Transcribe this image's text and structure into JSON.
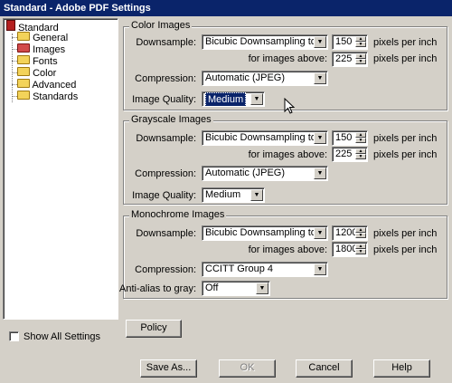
{
  "window": {
    "title": "Standard - Adobe PDF Settings"
  },
  "tree": {
    "root": "Standard",
    "items": [
      {
        "label": "General",
        "icon": "folder-icon"
      },
      {
        "label": "Images",
        "icon": "folder-icon",
        "selected": true
      },
      {
        "label": "Fonts",
        "icon": "folder-icon"
      },
      {
        "label": "Color",
        "icon": "folder-icon"
      },
      {
        "label": "Advanced",
        "icon": "folder-icon"
      },
      {
        "label": "Standards",
        "icon": "folder-icon"
      }
    ]
  },
  "color": {
    "title": "Color Images",
    "downsample_label": "Downsample:",
    "downsample_value": "Bicubic Downsampling to",
    "ppi_value": "150",
    "ppi_unit": "pixels per inch",
    "above_label": "for images above:",
    "above_value": "225",
    "above_unit": "pixels per inch",
    "compression_label": "Compression:",
    "compression_value": "Automatic (JPEG)",
    "quality_label": "Image Quality:",
    "quality_value": "Medium"
  },
  "gray": {
    "title": "Grayscale Images",
    "downsample_label": "Downsample:",
    "downsample_value": "Bicubic Downsampling to",
    "ppi_value": "150",
    "ppi_unit": "pixels per inch",
    "above_label": "for images above:",
    "above_value": "225",
    "above_unit": "pixels per inch",
    "compression_label": "Compression:",
    "compression_value": "Automatic (JPEG)",
    "quality_label": "Image Quality:",
    "quality_value": "Medium"
  },
  "mono": {
    "title": "Monochrome Images",
    "downsample_label": "Downsample:",
    "downsample_value": "Bicubic Downsampling to",
    "ppi_value": "1200",
    "ppi_unit": "pixels per inch",
    "above_label": "for images above:",
    "above_value": "1800",
    "above_unit": "pixels per inch",
    "compression_label": "Compression:",
    "compression_value": "CCITT Group 4",
    "antialias_label": "Anti-alias to gray:",
    "antialias_value": "Off"
  },
  "buttons": {
    "policy": "Policy",
    "save_as": "Save As...",
    "ok": "OK",
    "cancel": "Cancel",
    "help": "Help"
  },
  "show_all": {
    "label": "Show All Settings",
    "checked": false
  }
}
